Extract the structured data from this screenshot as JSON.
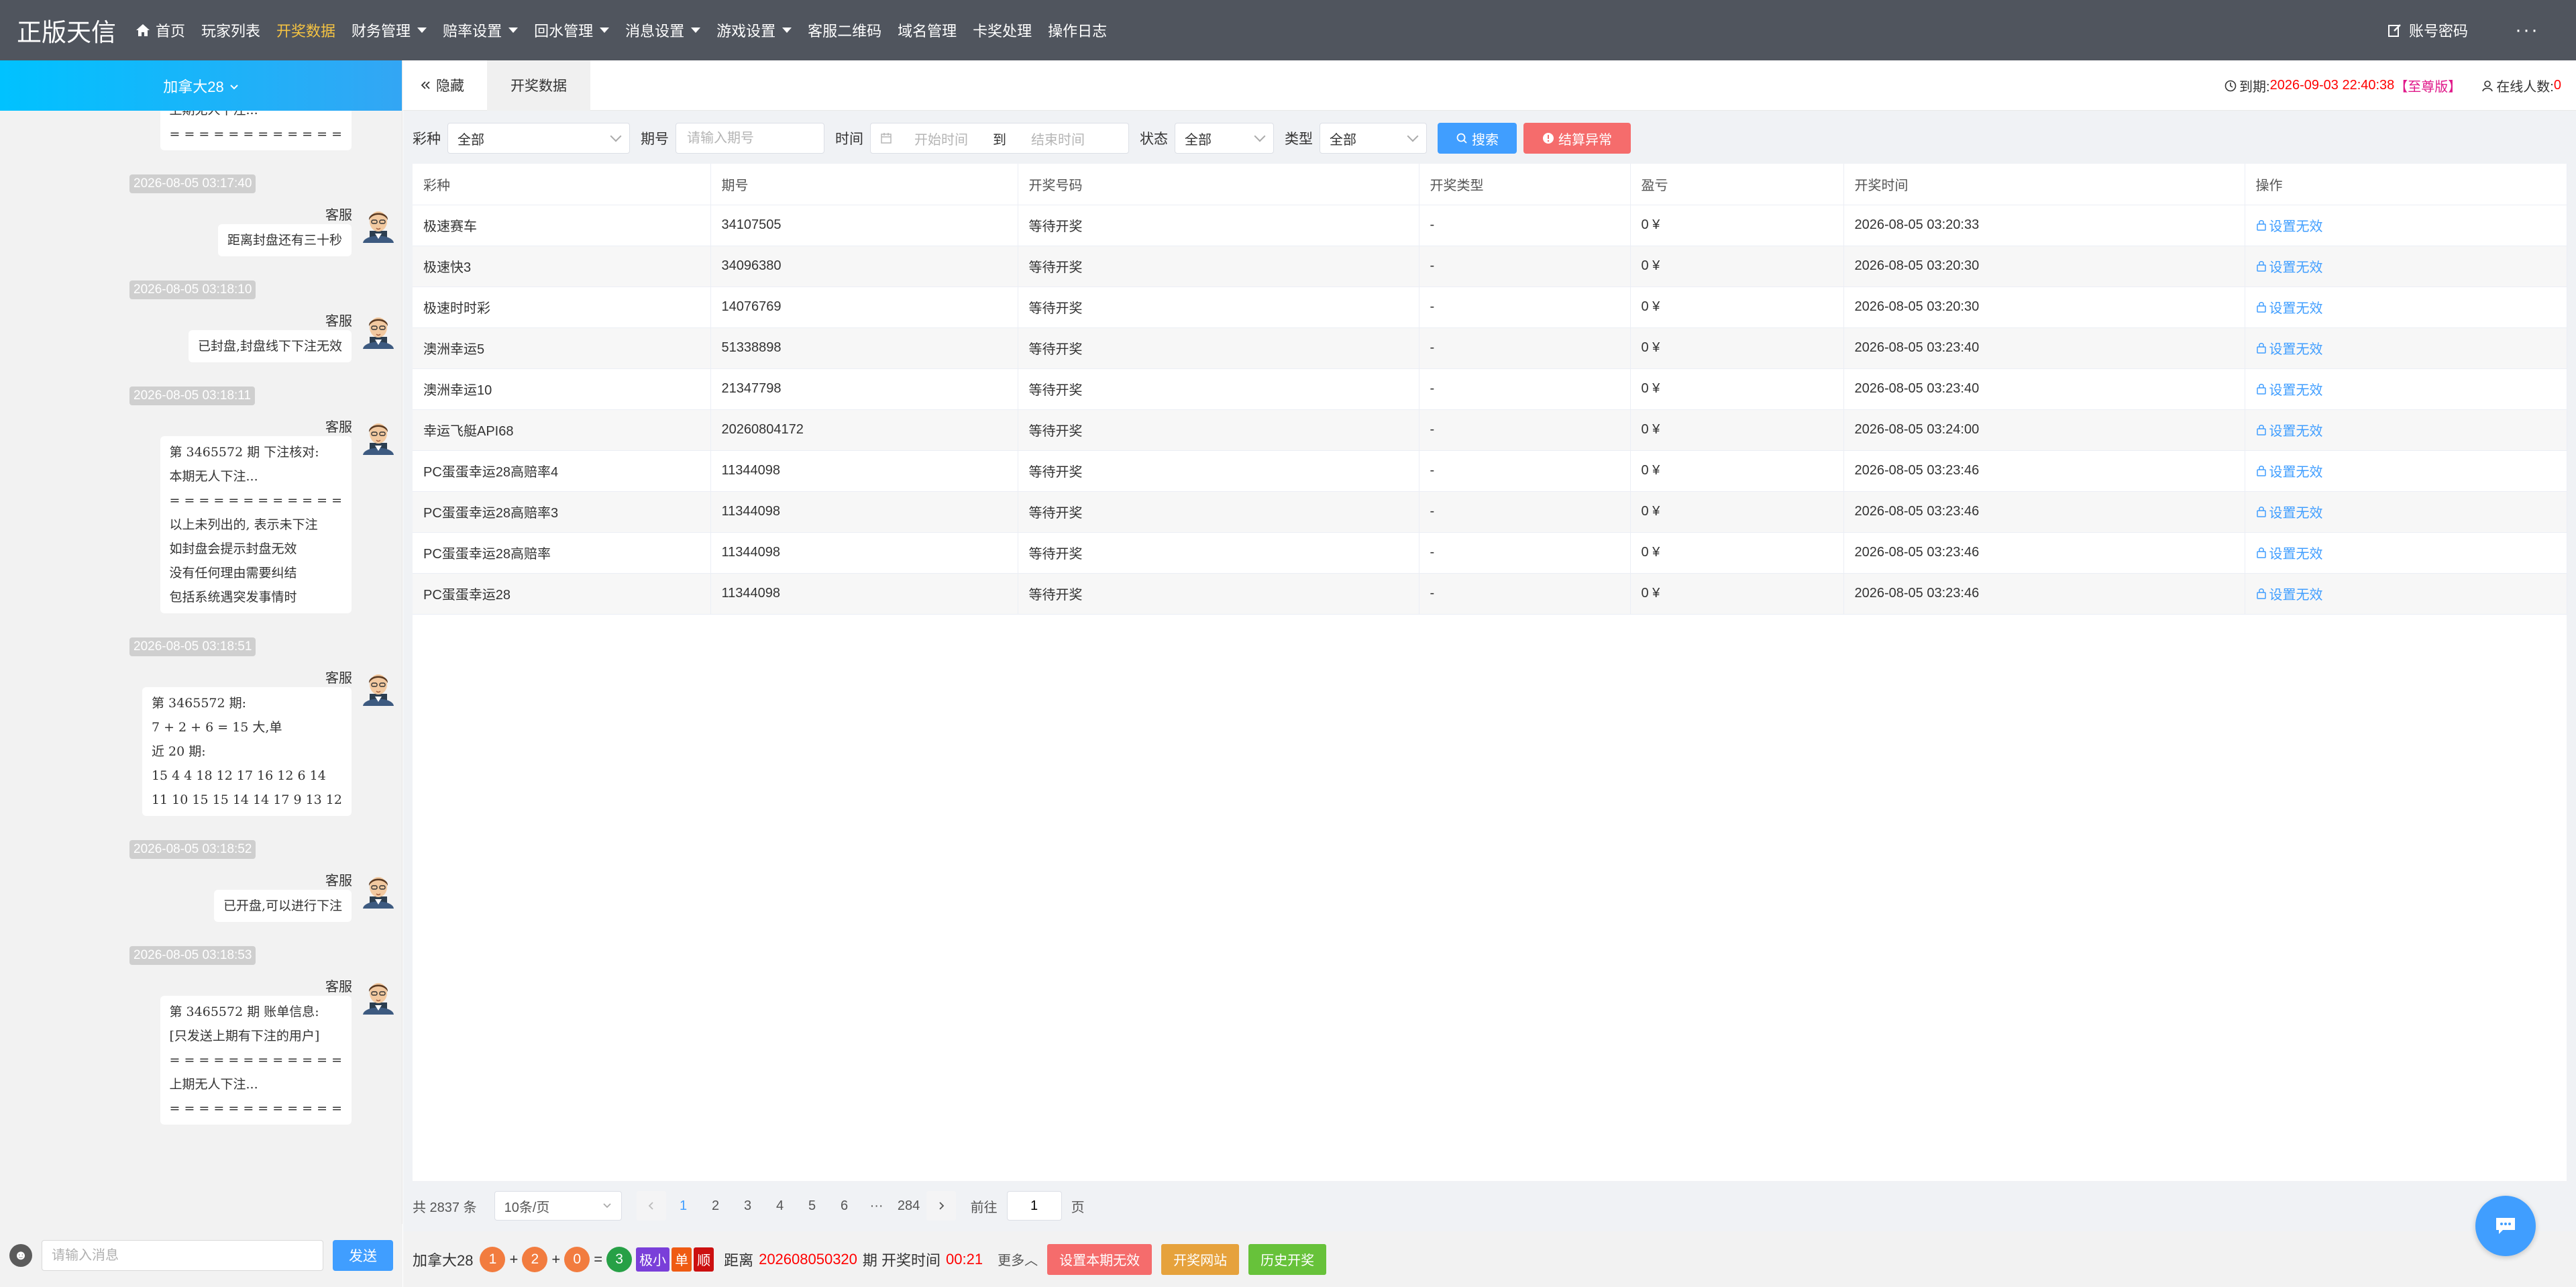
{
  "brand": {
    "logo_text": "正版天信"
  },
  "nav": {
    "items": [
      {
        "label": "首页",
        "has_caret": false,
        "active": false
      },
      {
        "label": "玩家列表",
        "has_caret": false,
        "active": false
      },
      {
        "label": "开奖数据",
        "has_caret": false,
        "active": true
      },
      {
        "label": "财务管理",
        "has_caret": true,
        "active": false
      },
      {
        "label": "赔率设置",
        "has_caret": true,
        "active": false
      },
      {
        "label": "回水管理",
        "has_caret": true,
        "active": false
      },
      {
        "label": "消息设置",
        "has_caret": true,
        "active": false
      },
      {
        "label": "游戏设置",
        "has_caret": true,
        "active": false
      },
      {
        "label": "客服二维码",
        "has_caret": false,
        "active": false
      },
      {
        "label": "域名管理",
        "has_caret": false,
        "active": false
      },
      {
        "label": "卡奖处理",
        "has_caret": false,
        "active": false
      },
      {
        "label": "操作日志",
        "has_caret": false,
        "active": false
      }
    ],
    "account_label": "账号密码",
    "more_label": "···"
  },
  "sidebar": {
    "room_title": "加拿大28",
    "messages": [
      {
        "type": "bubble",
        "lines": [
          "上期无人下注...",
          "= = = = = = = = = = = ="
        ]
      },
      {
        "type": "timestamp",
        "text": "2026-08-05 03:17:40"
      },
      {
        "type": "sender",
        "text": "客服"
      },
      {
        "type": "bubble",
        "lines": [
          "距离封盘还有三十秒"
        ]
      },
      {
        "type": "timestamp",
        "text": "2026-08-05 03:18:10"
      },
      {
        "type": "sender",
        "text": "客服"
      },
      {
        "type": "bubble",
        "lines": [
          "已封盘,封盘线下下注无效"
        ]
      },
      {
        "type": "timestamp",
        "text": "2026-08-05 03:18:11"
      },
      {
        "type": "sender",
        "text": "客服"
      },
      {
        "type": "bubble",
        "lines": [
          "第 3465572 期 下注核对:",
          "本期无人下注...",
          "= = = = = = = = = = = =",
          "以上未列出的, 表示未下注",
          "如封盘会提示封盘无效",
          "没有任何理由需要纠结",
          "包括系统遇突发事情时"
        ]
      },
      {
        "type": "timestamp",
        "text": "2026-08-05 03:18:51"
      },
      {
        "type": "sender",
        "text": "客服"
      },
      {
        "type": "bubble",
        "lines": [
          "第 3465572 期:",
          "7 + 2 + 6 = 15 大,单",
          "近 20 期:",
          "15 4 4 18 12 17 16 12 6 14",
          "11 10 15 15 14 14 17 9 13 12"
        ]
      },
      {
        "type": "timestamp",
        "text": "2026-08-05 03:18:52"
      },
      {
        "type": "sender",
        "text": "客服"
      },
      {
        "type": "bubble",
        "lines": [
          "已开盘,可以进行下注"
        ]
      },
      {
        "type": "timestamp",
        "text": "2026-08-05 03:18:53"
      },
      {
        "type": "sender",
        "text": "客服"
      },
      {
        "type": "bubble",
        "lines": [
          "第 3465572 期 账单信息:",
          "[只发送上期有下注的用户]",
          "= = = = = = = = = = = =",
          "上期无人下注...",
          "= = = = = = = = = = = ="
        ]
      }
    ],
    "input_placeholder": "请输入消息",
    "send_label": "发送"
  },
  "tabs": {
    "hide_label": "隐藏",
    "active_tab": "开奖数据"
  },
  "status": {
    "expire_label": "到期:",
    "expire_value": "2026-09-03 22:40:38",
    "edition": "【至尊版】",
    "online_label": "在线人数:",
    "online_value": "0"
  },
  "filters": {
    "lottery_label": "彩种",
    "lottery_value": "全部",
    "period_label": "期号",
    "period_placeholder": "请输入期号",
    "time_label": "时间",
    "start_placeholder": "开始时间",
    "to_label": "到",
    "end_placeholder": "结束时间",
    "state_label": "状态",
    "state_value": "全部",
    "type_label": "类型",
    "type_value": "全部",
    "search_label": "搜索",
    "abnormal_label": "结算异常"
  },
  "table": {
    "columns": [
      "彩种",
      "期号",
      "开奖号码",
      "开奖类型",
      "盈亏",
      "开奖时间",
      "操作"
    ],
    "rows": [
      [
        "极速赛车",
        "34107505",
        "等待开奖",
        "-",
        "0 ¥",
        "2026-08-05 03:20:33",
        "设置无效"
      ],
      [
        "极速快3",
        "34096380",
        "等待开奖",
        "-",
        "0 ¥",
        "2026-08-05 03:20:30",
        "设置无效"
      ],
      [
        "极速时时彩",
        "14076769",
        "等待开奖",
        "-",
        "0 ¥",
        "2026-08-05 03:20:30",
        "设置无效"
      ],
      [
        "澳洲幸运5",
        "51338898",
        "等待开奖",
        "-",
        "0 ¥",
        "2026-08-05 03:23:40",
        "设置无效"
      ],
      [
        "澳洲幸运10",
        "21347798",
        "等待开奖",
        "-",
        "0 ¥",
        "2026-08-05 03:23:40",
        "设置无效"
      ],
      [
        "幸运飞艇API68",
        "20260804172",
        "等待开奖",
        "-",
        "0 ¥",
        "2026-08-05 03:24:00",
        "设置无效"
      ],
      [
        "PC蛋蛋幸运28高赔率4",
        "11344098",
        "等待开奖",
        "-",
        "0 ¥",
        "2026-08-05 03:23:46",
        "设置无效"
      ],
      [
        "PC蛋蛋幸运28高赔率3",
        "11344098",
        "等待开奖",
        "-",
        "0 ¥",
        "2026-08-05 03:23:46",
        "设置无效"
      ],
      [
        "PC蛋蛋幸运28高赔率",
        "11344098",
        "等待开奖",
        "-",
        "0 ¥",
        "2026-08-05 03:23:46",
        "设置无效"
      ],
      [
        "PC蛋蛋幸运28",
        "11344098",
        "等待开奖",
        "-",
        "0 ¥",
        "2026-08-05 03:23:46",
        "设置无效"
      ]
    ]
  },
  "pagination": {
    "total_text": "共 2837 条",
    "page_size": "10条/页",
    "pages": [
      "1",
      "2",
      "3",
      "4",
      "5",
      "6",
      "···",
      "284"
    ],
    "current": "1",
    "goto_label": "前往",
    "goto_value": "1",
    "page_suffix": "页"
  },
  "bottombar": {
    "game": "加拿大28",
    "balls": [
      "1",
      "2",
      "0"
    ],
    "sum": "3",
    "tags": [
      "极小",
      "单",
      "顺"
    ],
    "distance_label": "距离",
    "period": "202608050320",
    "period_suffix": "期 开奖时间",
    "countdown": "00:21",
    "more_label": "更多",
    "btn_invalid": "设置本期无效",
    "btn_site": "开奖网站",
    "btn_history": "历史开奖"
  },
  "colors": {
    "nav_bg": "#50555e",
    "nav_active": "#f5c342",
    "primary": "#409eff",
    "danger": "#f56c6c",
    "warning": "#e6a23c",
    "success": "#67c23a"
  }
}
